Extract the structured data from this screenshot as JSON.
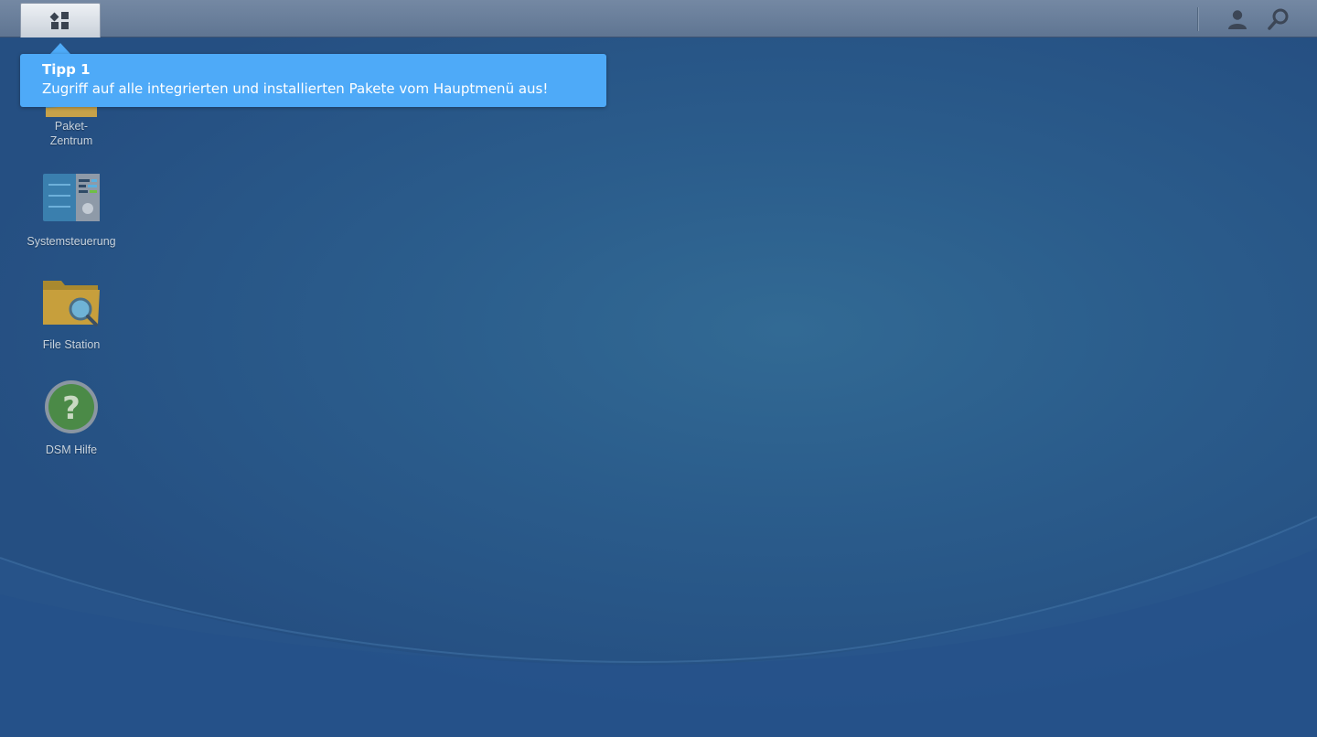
{
  "taskbar": {
    "main_menu_icon": "main-menu-grid-icon",
    "user_icon": "user-icon",
    "search_icon": "search-icon"
  },
  "tip": {
    "title": "Tipp 1",
    "text": "Zugriff auf alle integrierten und installierten Pakete vom Hauptmenü aus!"
  },
  "desktop_icons": [
    {
      "label_line1": "Paket-",
      "label_line2": "Zentrum",
      "icon": "package-center-icon"
    },
    {
      "label": "Systemsteuerung",
      "icon": "control-panel-icon"
    },
    {
      "label": "File Station",
      "icon": "file-station-folder-icon"
    },
    {
      "label": "DSM Hilfe",
      "icon": "help-question-icon"
    }
  ],
  "colors": {
    "desktop_bg": "#2b5d8c",
    "taskbar_bg": "#6a7f9b",
    "tip_bg": "#4eaaf8",
    "icon_label": "#c8d3de"
  }
}
